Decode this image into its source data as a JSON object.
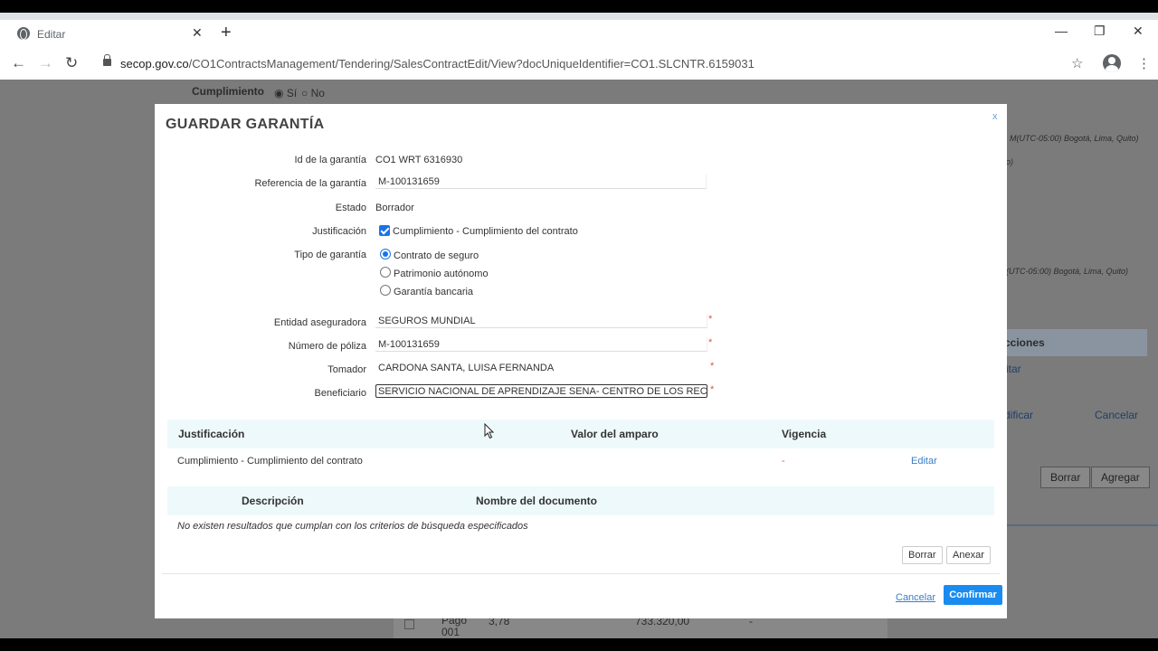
{
  "browser": {
    "tab_title": "Editar",
    "url_domain": "secop.gov.co",
    "url_path": "/CO1ContractsManagement/Tendering/SalesContractEdit/View?docUniqueIdentifier=CO1.SLCNTR.6159031"
  },
  "background": {
    "cumplimiento_label": "Cumplimiento",
    "si_label": "Sí",
    "no_label": "No",
    "timezone_1": "M(UTC-05:00) Bogotá, Lima, Quito)",
    "snip_1": "o)",
    "timezone_2": "(UTC-05:00) Bogotá, Lima, Quito)",
    "acciones_header": "cciones",
    "editar_link": "itar",
    "modificar_link": "dificar",
    "cancelar_link": "Cancelar",
    "borrar_button": "Borrar",
    "agregar_button": "Agregar",
    "pago_label": "Pago 001",
    "pago_value": "3,78",
    "pago_amount": "733.320,00",
    "pago_dash": "-"
  },
  "modal": {
    "title": "GUARDAR GARANTÍA",
    "close_label": "x",
    "fields": {
      "id_label": "Id de la garantía",
      "id_value": "CO1 WRT 6316930",
      "referencia_label": "Referencia de la garantía",
      "referencia_value": "M-100131659",
      "estado_label": "Estado",
      "estado_value": "Borrador",
      "justificacion_label": "Justificación",
      "justificacion_option": "Cumplimiento - Cumplimiento del contrato",
      "tipo_label": "Tipo de garantía",
      "tipo_options": [
        "Contrato de seguro",
        "Patrimonio autónomo",
        "Garantía bancaria"
      ],
      "tipo_selected": "Contrato de seguro",
      "entidad_label": "Entidad aseguradora",
      "entidad_value": "SEGUROS MUNDIAL",
      "poliza_label": "Número de póliza",
      "poliza_value": "M-100131659",
      "tomador_label": "Tomador",
      "tomador_value": "CARDONA SANTA, LUISA FERNANDA",
      "beneficiario_label": "Beneficiario",
      "beneficiario_value": "SERVICIO NACIONAL DE APRENDIZAJE SENA- CENTRO DE LOS RECURS",
      "required_mark": "*"
    },
    "amparos_table": {
      "headers": [
        "Justificación",
        "Valor del amparo",
        "Vigencia"
      ],
      "rows": [
        {
          "justificacion": "Cumplimiento - Cumplimiento del contrato",
          "valor": "",
          "vigencia": "-",
          "action": "Editar"
        }
      ]
    },
    "documentos_table": {
      "headers": [
        "Descripción",
        "Nombre del documento"
      ],
      "empty_message": "No existen resultados que cumplan con los criterios de búsqueda especificados",
      "borrar_label": "Borrar",
      "anexar_label": "Anexar"
    },
    "footer": {
      "cancel_label": "Cancelar",
      "confirm_label": "Confirmar"
    }
  }
}
